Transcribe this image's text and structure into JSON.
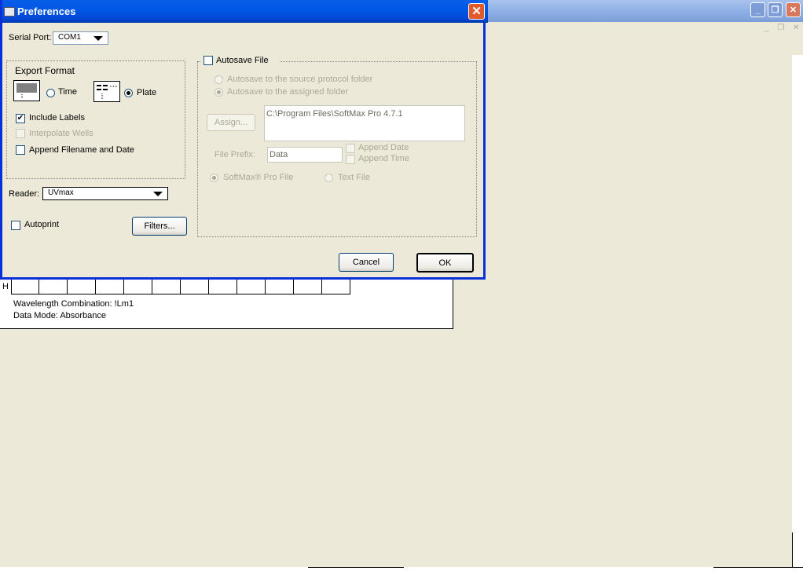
{
  "background_app": {
    "window_controls": {
      "minimize": "_",
      "maximize": "❐",
      "close": "✕"
    },
    "mdi_controls": "_ ❐ ✕",
    "plate_row_label": "H",
    "plate_info": {
      "wavelength": "Wavelength Combination: !Lm1",
      "data_mode": "Data Mode: Absorbance"
    }
  },
  "dialog": {
    "title": "Preferences",
    "close": "✕",
    "serial_port": {
      "label": "Serial Port:",
      "value": "COM1"
    },
    "export_format": {
      "title": "Export Format",
      "time_label": "Time",
      "plate_label": "Plate",
      "selected": "Plate",
      "include_labels": {
        "label": "Include Labels",
        "checked": true
      },
      "interpolate_wells": {
        "label": "Interpolate Wells",
        "checked": false,
        "enabled": false
      },
      "append_filename": {
        "label": "Append Filename and Date",
        "checked": false
      }
    },
    "reader": {
      "label": "Reader:",
      "value": "UVmax"
    },
    "autoprint": {
      "label": "Autoprint",
      "checked": false
    },
    "filters_button": "Filters...",
    "autosave": {
      "label": "Autosave File",
      "checked": false,
      "source_folder": "Autosave to the source protocol folder",
      "assigned_folder": "Autosave to the assigned folder",
      "assign_button": "Assign...",
      "path": "C:\\Program Files\\SoftMax Pro 4.7.1",
      "file_prefix_label": "File Prefix:",
      "file_prefix_value": "Data",
      "append_date": "Append Date",
      "append_time": "Append Time",
      "softmax_file": "SoftMax® Pro File",
      "text_file": "Text File"
    },
    "cancel_button": "Cancel",
    "ok_button": "OK"
  },
  "colors": {
    "dialog_title_blue": "#0058e6",
    "close_red": "#e05a2a",
    "window_face": "#ece9d8",
    "disabled_text": "#aca899"
  }
}
